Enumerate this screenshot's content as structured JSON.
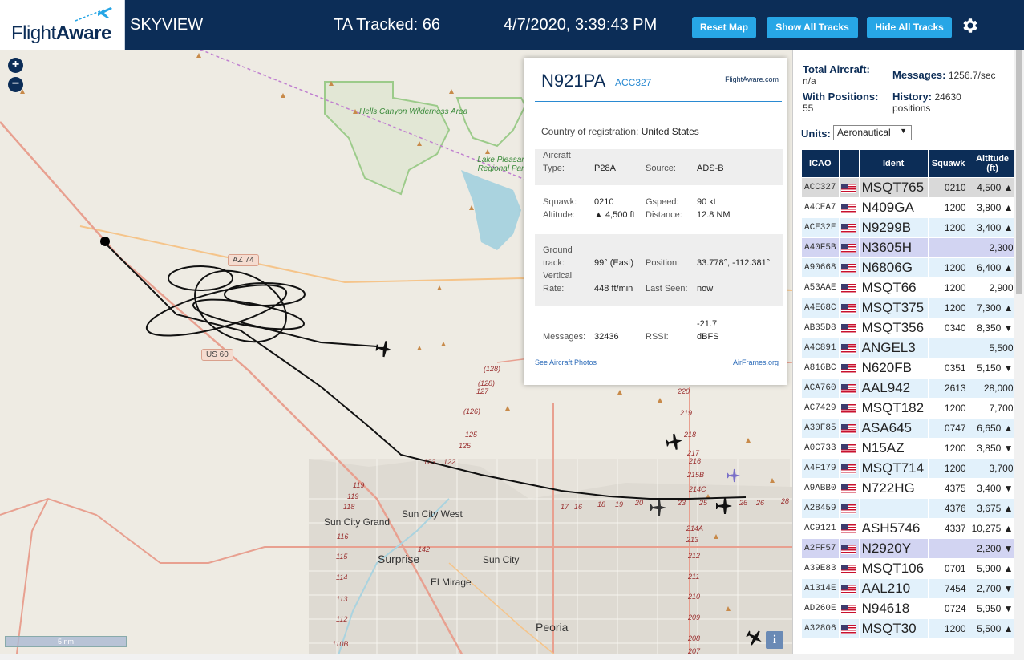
{
  "header": {
    "logo_text_a": "Flight",
    "logo_text_b": "Aware",
    "app_name": "SKYVIEW",
    "ta_tracked": "TA Tracked: 66",
    "datetime": "4/7/2020, 3:39:43 PM",
    "buttons": {
      "reset_map": "Reset Map",
      "show_all_tracks": "Show All Tracks",
      "hide_all_tracks": "Hide All Tracks"
    },
    "icons": {
      "logo": "flightaware-plane-logo-icon",
      "settings": "gear-icon"
    },
    "colors": {
      "navy": "#0c2d57",
      "button": "#27a6e6"
    }
  },
  "map": {
    "zoom_in": "+",
    "zoom_out": "−",
    "scale_label": "5 nm",
    "info": "i",
    "labels": {
      "park1": "Hells Canyon Wilderness Area",
      "park2": "Lake Pleasant Regional Park",
      "az74": "AZ 74",
      "us60": "US 60",
      "sun_city_west": "Sun City West",
      "sun_city_grand": "Sun City Grand",
      "surprise": "Surprise",
      "sun_city": "Sun City",
      "el_mirage": "El Mirage",
      "peoria": "Peoria"
    },
    "route_numbers": [
      "(128)",
      "(128)",
      "127",
      "(126)",
      "125",
      "125",
      "123",
      "122",
      "119",
      "119",
      "118",
      "116",
      "115",
      "114",
      "113",
      "112",
      "110B",
      "142",
      "220",
      "219",
      "218",
      "217",
      "216",
      "215B",
      "214C",
      "214A",
      "213",
      "212",
      "211",
      "210",
      "209",
      "208",
      "207",
      "17",
      "16",
      "18",
      "19",
      "20",
      "23",
      "25",
      "26",
      "26",
      "28"
    ]
  },
  "popup": {
    "registration": "N921PA",
    "icao": "ACC327",
    "link": "FlightAware.com",
    "country_label": "Country of registration:",
    "country_value": "United States",
    "aircraft_type_label_a": "Aircraft",
    "aircraft_type_label_b": "Type:",
    "aircraft_type": "P28A",
    "source_label": "Source:",
    "source": "ADS-B",
    "squawk_label": "Squawk:",
    "squawk": "0210",
    "gspeed_label": "Gspeed:",
    "gspeed": "90 kt",
    "altitude_label": "Altitude:",
    "altitude": "▲ 4,500 ft",
    "distance_label": "Distance:",
    "distance": "12.8 NM",
    "ground_track_label_a": "Ground",
    "ground_track_label_b": "track:",
    "ground_track": "99° (East)",
    "position_label": "Position:",
    "position": "33.778°, -112.381°",
    "vertical_label_a": "Vertical",
    "vertical_label_b": "Rate:",
    "vertical_rate": "448 ft/min",
    "last_seen_label": "Last Seen:",
    "last_seen": "now",
    "messages_label": "Messages:",
    "messages": "32436",
    "rssi_label": "RSSI:",
    "rssi_a": "-21.7",
    "rssi_b": "dBFS",
    "photos_link": "See Aircraft Photos",
    "airframes_link": "AirFrames.org"
  },
  "sidebar": {
    "total_aircraft_label": "Total Aircraft:",
    "total_aircraft": "n/a",
    "messages_label": "Messages:",
    "messages": "1256.7/sec",
    "with_positions_label": "With Positions:",
    "with_positions": "55",
    "history_label": "History:",
    "history_a": "24630",
    "history_b": "positions",
    "units_label": "Units:",
    "units_value": "Aeronautical",
    "columns": {
      "icao": "ICAO",
      "ident": "Ident",
      "squawk": "Squawk",
      "altitude_a": "Altitude",
      "altitude_b": "(ft)"
    },
    "rows": [
      {
        "icao": "ACC327",
        "ident": "MSQT765",
        "squawk": "0210",
        "alt": "4,500 ▲"
      },
      {
        "icao": "A4CEA7",
        "ident": "N409GA",
        "squawk": "1200",
        "alt": "3,800 ▲"
      },
      {
        "icao": "ACE32E",
        "ident": "N9299B",
        "squawk": "1200",
        "alt": "3,400 ▲"
      },
      {
        "icao": "A40F5B",
        "ident": "N3605H",
        "squawk": "",
        "alt": "2,300"
      },
      {
        "icao": "A90668",
        "ident": "N6806G",
        "squawk": "1200",
        "alt": "6,400 ▲"
      },
      {
        "icao": "A53AAE",
        "ident": "MSQT66",
        "squawk": "1200",
        "alt": "2,900"
      },
      {
        "icao": "A4E68C",
        "ident": "MSQT375",
        "squawk": "1200",
        "alt": "7,300 ▲"
      },
      {
        "icao": "AB35D8",
        "ident": "MSQT356",
        "squawk": "0340",
        "alt": "8,350 ▼"
      },
      {
        "icao": "A4C891",
        "ident": "ANGEL3",
        "squawk": "",
        "alt": "5,500"
      },
      {
        "icao": "A816BC",
        "ident": "N620FB",
        "squawk": "0351",
        "alt": "5,150 ▼"
      },
      {
        "icao": "ACA760",
        "ident": "AAL942",
        "squawk": "2613",
        "alt": "28,000"
      },
      {
        "icao": "AC7429",
        "ident": "MSQT182",
        "squawk": "1200",
        "alt": "7,700"
      },
      {
        "icao": "A30F85",
        "ident": "ASA645",
        "squawk": "0747",
        "alt": "6,650 ▲"
      },
      {
        "icao": "A0C733",
        "ident": "N15AZ",
        "squawk": "1200",
        "alt": "3,850 ▼"
      },
      {
        "icao": "A4F179",
        "ident": "MSQT714",
        "squawk": "1200",
        "alt": "3,700"
      },
      {
        "icao": "A9ABB0",
        "ident": "N722HG",
        "squawk": "4375",
        "alt": "3,400 ▼"
      },
      {
        "icao": "A28459",
        "ident": "",
        "squawk": "4376",
        "alt": "3,675 ▲"
      },
      {
        "icao": "AC9121",
        "ident": "ASH5746",
        "squawk": "4337",
        "alt": "10,275 ▲"
      },
      {
        "icao": "A2FF57",
        "ident": "N2920Y",
        "squawk": "",
        "alt": "2,200 ▼"
      },
      {
        "icao": "A39E83",
        "ident": "MSQT106",
        "squawk": "0701",
        "alt": "5,900 ▲"
      },
      {
        "icao": "A1314E",
        "ident": "AAL210",
        "squawk": "7454",
        "alt": "2,700 ▼"
      },
      {
        "icao": "AD260E",
        "ident": "N94618",
        "squawk": "0724",
        "alt": "5,950 ▼"
      },
      {
        "icao": "A32806",
        "ident": "MSQT30",
        "squawk": "1200",
        "alt": "5,500 ▲"
      }
    ]
  }
}
